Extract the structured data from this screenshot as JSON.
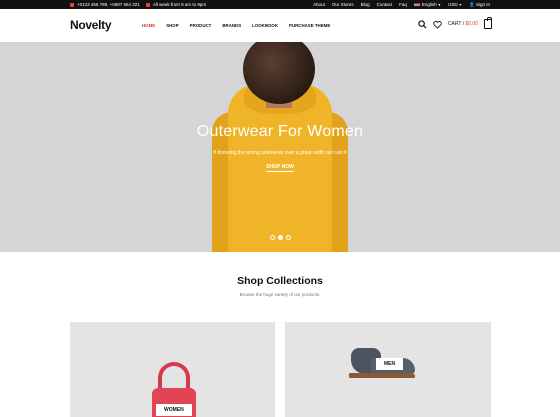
{
  "topbar": {
    "phone": "+0123 456 789, +0987 654 321",
    "hours": "All week from 9 am to 9pm",
    "links": [
      "About",
      "Our Stores",
      "Blog",
      "Contact",
      "Faq"
    ],
    "language": "English",
    "currency": "USD",
    "signin": "Sign In"
  },
  "header": {
    "logo": "Novelty",
    "nav": [
      "HOME",
      "SHOP",
      "PRODUCT",
      "BRANDS",
      "LOOKBOOK",
      "PURCHASE THEME"
    ],
    "active_nav": "HOME",
    "cart_label": "CART / ",
    "cart_price": "$0.00"
  },
  "hero": {
    "title": "Outerwear For Women",
    "subtitle": "If throwing the wrong outerwear over a great outfit can ruin it",
    "cta": "SHOP NOW",
    "slides": 3,
    "active_slide": 2
  },
  "collections": {
    "title": "Shop Collections",
    "subtitle": "Browse the huge variety of our products.",
    "cards": [
      {
        "label": "WOMEN"
      },
      {
        "label": "MEN"
      }
    ]
  },
  "colors": {
    "accent": "#e0353a",
    "topbar_bg": "#111111",
    "hero_bg": "#d5d5d7",
    "card_bg": "#e4e4e4"
  }
}
